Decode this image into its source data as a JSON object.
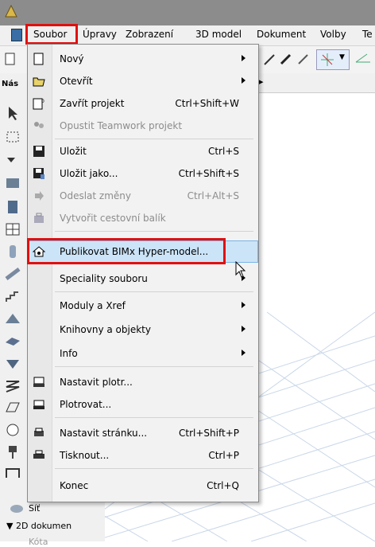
{
  "menubar": {
    "items": [
      "Soubor",
      "Úpravy",
      "Zobrazení",
      "3D model",
      "Dokument",
      "Volby",
      "Te"
    ]
  },
  "left_panel": {
    "label_top": "Nás",
    "bottom_items": [
      "Síť",
      "▼ 2D dokumen",
      "Kóta"
    ]
  },
  "file_menu": {
    "items": [
      {
        "label": "Nový",
        "shortcut": "",
        "submenu": true,
        "disabled": false
      },
      {
        "label": "Otevřít",
        "shortcut": "",
        "submenu": true,
        "disabled": false
      },
      {
        "label": "Zavřít projekt",
        "shortcut": "Ctrl+Shift+W",
        "submenu": false,
        "disabled": false
      },
      {
        "label": "Opustit Teamwork projekt",
        "shortcut": "",
        "submenu": false,
        "disabled": true
      },
      {
        "label": "Uložit",
        "shortcut": "Ctrl+S",
        "submenu": false,
        "disabled": false
      },
      {
        "label": "Uložit jako...",
        "shortcut": "Ctrl+Shift+S",
        "submenu": false,
        "disabled": false
      },
      {
        "label": "Odeslat změny",
        "shortcut": "Ctrl+Alt+S",
        "submenu": false,
        "disabled": true
      },
      {
        "label": "Vytvořit cestovní balík",
        "shortcut": "",
        "submenu": false,
        "disabled": true
      },
      {
        "label": "Publikovat BIMx Hyper-model...",
        "shortcut": "",
        "submenu": false,
        "disabled": false
      },
      {
        "label": "Speciality souboru",
        "shortcut": "",
        "submenu": true,
        "disabled": false
      },
      {
        "label": "Moduly a Xref",
        "shortcut": "",
        "submenu": true,
        "disabled": false
      },
      {
        "label": "Knihovny a objekty",
        "shortcut": "",
        "submenu": true,
        "disabled": false
      },
      {
        "label": "Info",
        "shortcut": "",
        "submenu": true,
        "disabled": false
      },
      {
        "label": "Nastavit plotr...",
        "shortcut": "",
        "submenu": false,
        "disabled": false
      },
      {
        "label": "Plotrovat...",
        "shortcut": "",
        "submenu": false,
        "disabled": false
      },
      {
        "label": "Nastavit stránku...",
        "shortcut": "Ctrl+Shift+P",
        "submenu": false,
        "disabled": false
      },
      {
        "label": "Tisknout...",
        "shortcut": "Ctrl+P",
        "submenu": false,
        "disabled": false
      },
      {
        "label": "Konec",
        "shortcut": "Ctrl+Q",
        "submenu": false,
        "disabled": false
      }
    ]
  },
  "colors": {
    "highlight_box": "#e01010",
    "hover": "#cce4f7"
  }
}
